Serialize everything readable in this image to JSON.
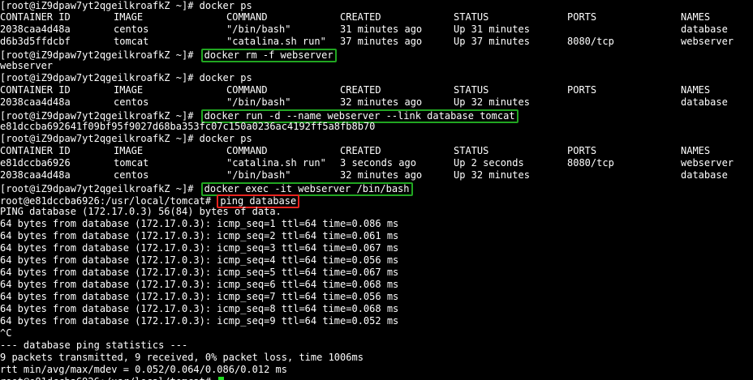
{
  "theme": {
    "background": "#000000",
    "foreground": "#ffffff",
    "highlight_green": "#21a621",
    "highlight_red": "#e8231e",
    "cursor_color": "#22dd22"
  },
  "prompt_host": "[root@iZ9dpaw7yt2qgeilkroafkZ ~]# ",
  "prompt_container": "root@e81dccba6926:/usr/local/tomcat# ",
  "ps_headers": [
    "CONTAINER ID",
    "IMAGE",
    "COMMAND",
    "CREATED",
    "STATUS",
    "PORTS",
    "NAMES"
  ],
  "block1": {
    "command": "docker ps",
    "rows": [
      [
        "2038caa4d48a",
        "centos",
        "\"/bin/bash\"",
        "31 minutes ago",
        "Up 31 minutes",
        "",
        "database"
      ],
      [
        "d6b3d5ffdcbf",
        "tomcat",
        "\"catalina.sh run\"",
        "37 minutes ago",
        "Up 37 minutes",
        "8080/tcp",
        "webserver"
      ]
    ]
  },
  "block2": {
    "command": "docker rm -f webserver",
    "output": "webserver"
  },
  "block3": {
    "command": "docker ps",
    "rows": [
      [
        "2038caa4d48a",
        "centos",
        "\"/bin/bash\"",
        "32 minutes ago",
        "Up 32 minutes",
        "",
        "database"
      ]
    ]
  },
  "block4": {
    "command": "docker run -d --name webserver --link database tomcat",
    "output": "e81dccba692641f09bf95f9027d68ba353fc07c150a0236ac4192ff5a8fb8b70"
  },
  "block5": {
    "command": "docker ps",
    "rows": [
      [
        "e81dccba6926",
        "tomcat",
        "\"catalina.sh run\"",
        "3 seconds ago",
        "Up 2 seconds",
        "8080/tcp",
        "webserver"
      ],
      [
        "2038caa4d48a",
        "centos",
        "\"/bin/bash\"",
        "32 minutes ago",
        "Up 32 minutes",
        "",
        "database"
      ]
    ]
  },
  "block6": {
    "command": "docker exec -it webserver /bin/bash"
  },
  "block7": {
    "command": "ping database",
    "header": "PING database (172.17.0.3) 56(84) bytes of data.",
    "replies": [
      "64 bytes from database (172.17.0.3): icmp_seq=1 ttl=64 time=0.086 ms",
      "64 bytes from database (172.17.0.3): icmp_seq=2 ttl=64 time=0.061 ms",
      "64 bytes from database (172.17.0.3): icmp_seq=3 ttl=64 time=0.067 ms",
      "64 bytes from database (172.17.0.3): icmp_seq=4 ttl=64 time=0.056 ms",
      "64 bytes from database (172.17.0.3): icmp_seq=5 ttl=64 time=0.067 ms",
      "64 bytes from database (172.17.0.3): icmp_seq=6 ttl=64 time=0.068 ms",
      "64 bytes from database (172.17.0.3): icmp_seq=7 ttl=64 time=0.056 ms",
      "64 bytes from database (172.17.0.3): icmp_seq=8 ttl=64 time=0.068 ms",
      "64 bytes from database (172.17.0.3): icmp_seq=9 ttl=64 time=0.052 ms"
    ],
    "interrupt": "^C",
    "stats_title": "--- database ping statistics ---",
    "stats_packets": "9 packets transmitted, 9 received, 0% packet loss, time 1006ms",
    "stats_rtt": "rtt min/avg/max/mdev = 0.052/0.064/0.086/0.012 ms"
  }
}
